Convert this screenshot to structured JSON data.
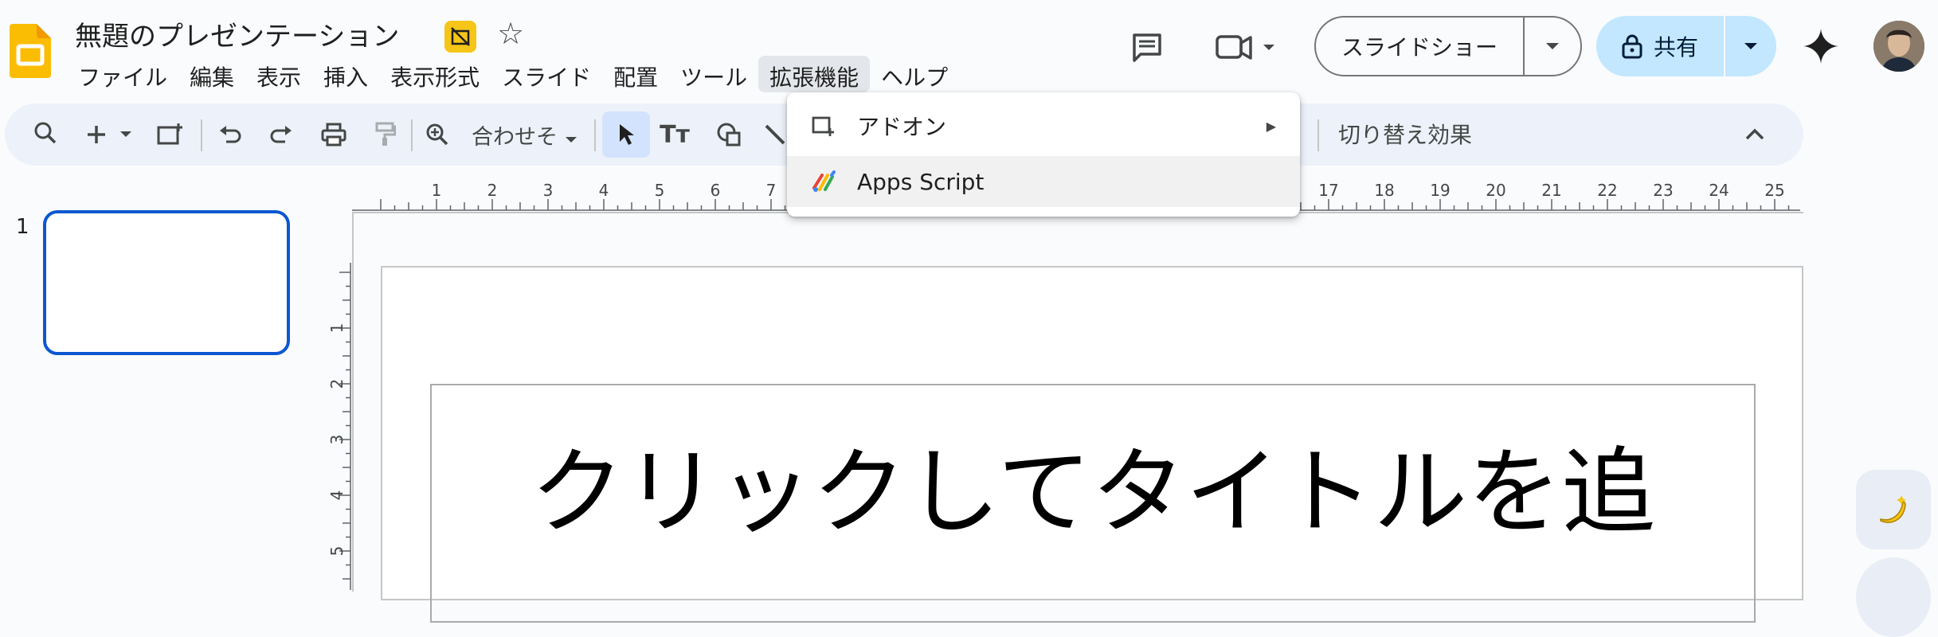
{
  "header": {
    "doc_title": "無題のプレゼンテーション",
    "menu": [
      "ファイル",
      "編集",
      "表示",
      "挿入",
      "表示形式",
      "スライド",
      "配置",
      "ツール",
      "拡張機能",
      "ヘルプ"
    ],
    "slideshow_label": "スライドショー",
    "share_label": "共有"
  },
  "toolbar": {
    "zoom_label": "合わせそ",
    "transition_label": "切り替え効果"
  },
  "extensions_menu": {
    "items": [
      {
        "label": "アドオン",
        "icon": "addon-icon",
        "has_submenu": true
      },
      {
        "label": "Apps Script",
        "icon": "apps-script-icon",
        "has_submenu": false
      }
    ]
  },
  "ruler": {
    "h_labels": [
      "1",
      "2",
      "3",
      "4",
      "5",
      "6",
      "7",
      "17",
      "18",
      "19",
      "20",
      "21",
      "22",
      "23",
      "24",
      "25"
    ],
    "v_labels": [
      "1",
      "2",
      "3",
      "4",
      "5"
    ]
  },
  "filmstrip": {
    "slide_number": "1"
  },
  "slide": {
    "title": "クリックしてタイトルを追"
  },
  "colors": {
    "accent": "#0b57d0",
    "share_bg": "#c2e7ff",
    "toolbar_bg": "#edf2fa"
  }
}
